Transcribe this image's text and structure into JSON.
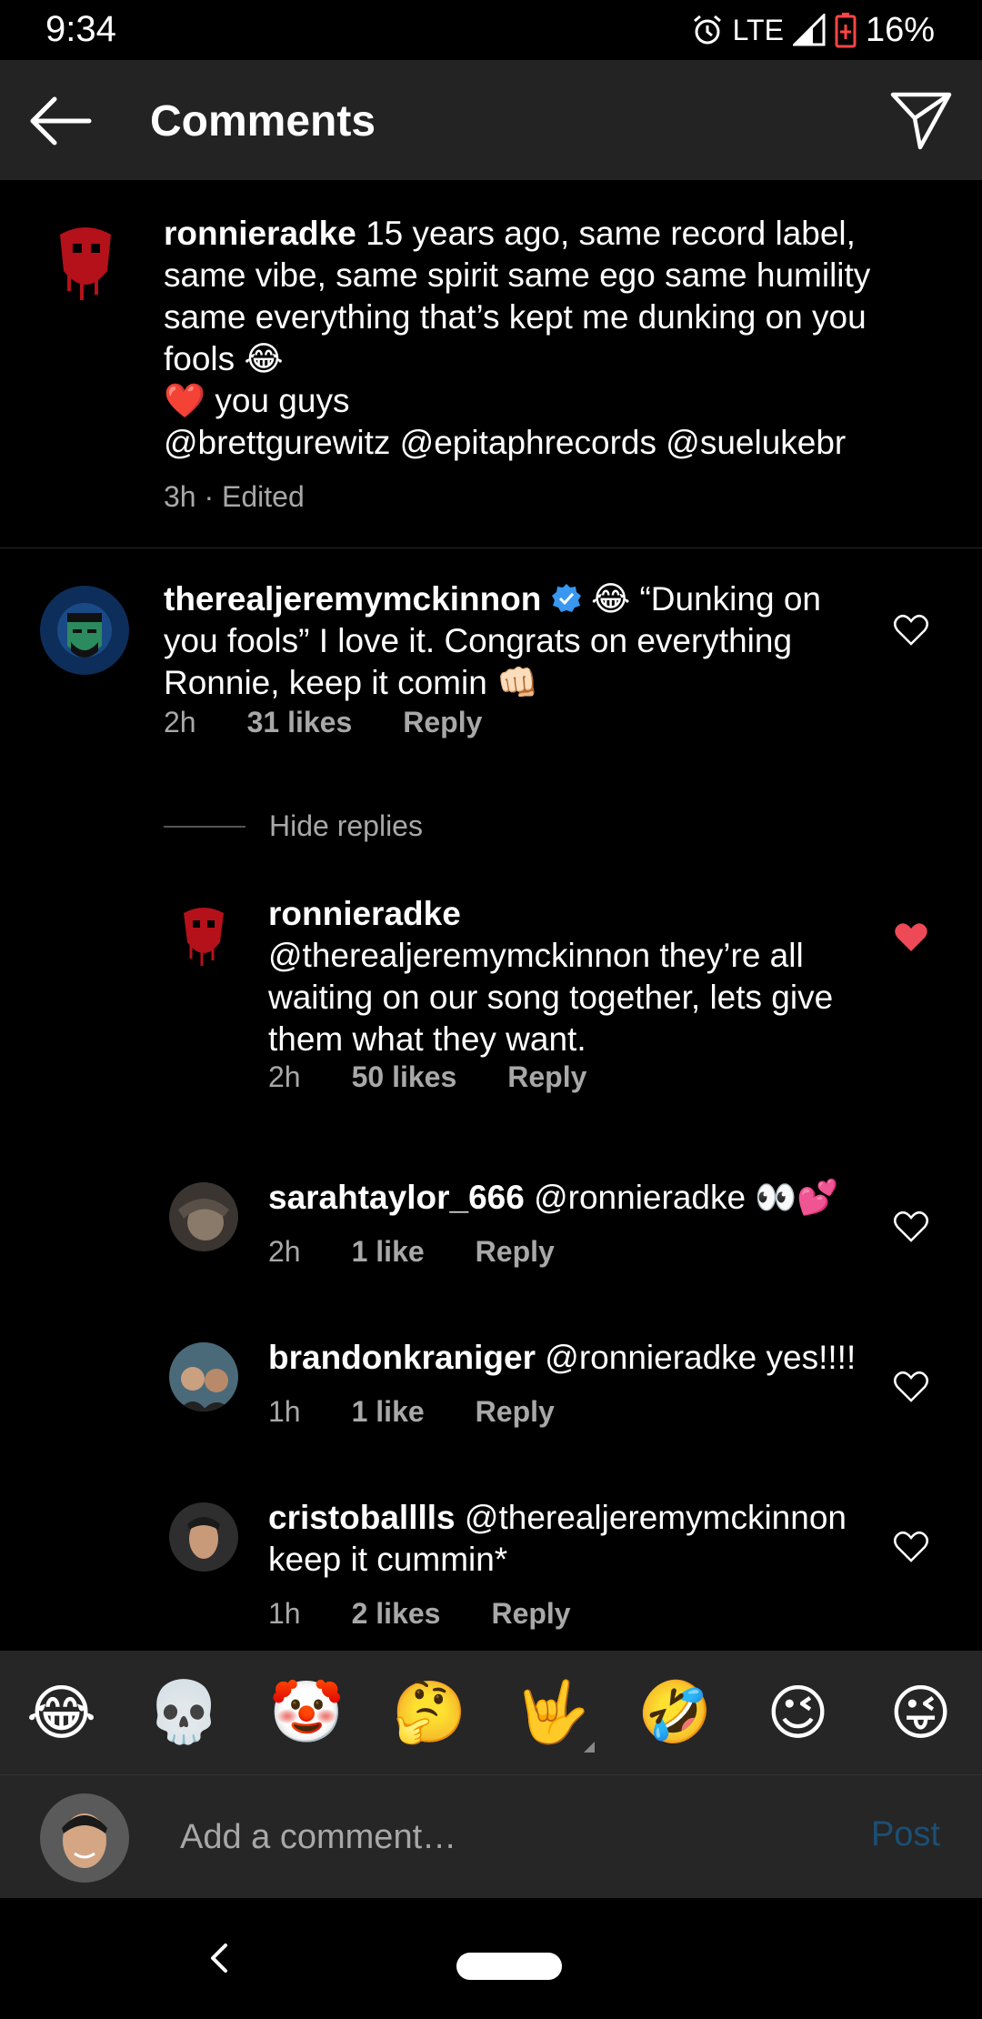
{
  "status": {
    "time": "9:34",
    "network": "LTE",
    "battery": "16%"
  },
  "header": {
    "title": "Comments"
  },
  "caption": {
    "username": "ronnieradke",
    "text": " 15 years ago, same record label, same vibe, same spirit same ego same humility same everything that’s kept me dunking on you fools 😂",
    "line2": " you guys",
    "heart_emoji": "❤️",
    "mentions": "@brettgurewitz @epitaphrecords @suelukebr",
    "meta": "3h · Edited"
  },
  "comments": [
    {
      "username": "therealjeremymckinnon",
      "text": " 😂 “Dunking on you fools” I love it. Congrats on everything Ronnie, keep it comin 👊🏻",
      "time": "2h",
      "likes": "31 likes",
      "reply": "Reply"
    }
  ],
  "hide_replies": "Hide replies",
  "replies": [
    {
      "username": "ronnieradke",
      "text": "@therealjeremymckinnon they’re all waiting on our song together, lets give them what they want.",
      "time": "2h",
      "likes": "50 likes",
      "reply": "Reply"
    },
    {
      "username": "sarahtaylor_666",
      "text": " @ronnieradke 👀💕",
      "time": "2h",
      "likes": "1 like",
      "reply": "Reply"
    },
    {
      "username": "brandonkraniger",
      "text": " @ronnieradke yes!!!!",
      "time": "1h",
      "likes": "1 like",
      "reply": "Reply"
    },
    {
      "username": "cristoballlls",
      "text": " @therealjeremymckinnon keep it cummin*",
      "time": "1h",
      "likes": "2 likes",
      "reply": "Reply"
    }
  ],
  "emoji_bar": [
    "😂",
    "💀",
    "🤡",
    "🤔",
    "🤟",
    "🤣",
    "😉",
    "😜"
  ],
  "input": {
    "placeholder": "Add a comment…",
    "post": "Post"
  },
  "colors": {
    "liked_heart": "#ed4956",
    "post_disabled": "#1c4f74"
  }
}
